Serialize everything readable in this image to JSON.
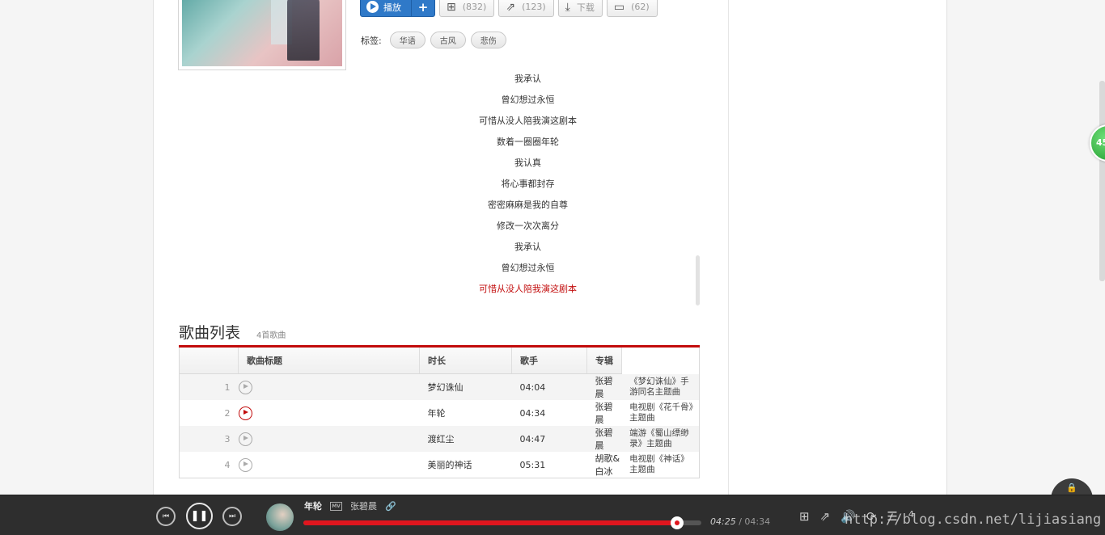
{
  "song_actions": {
    "play_label": "播放",
    "add_label": "+",
    "collect_count": "(832)",
    "share_count": "(123)",
    "download_label": "下载",
    "comment_count": "(62)"
  },
  "tags": {
    "label": "标签:",
    "items": [
      "华语",
      "古风",
      "悲伤"
    ]
  },
  "lyrics": {
    "lines": [
      "我承认",
      "曾幻想过永恒",
      "可惜从没人陪我演这剧本",
      "数着一圈圈年轮",
      "我认真",
      "将心事都封存",
      "密密麻麻是我的自尊",
      "修改一次次离分",
      "我承认",
      "曾幻想过永恒",
      "可惜从没人陪我演这剧本"
    ],
    "current_index": 10
  },
  "song_list": {
    "title": "歌曲列表",
    "count": "4首歌曲",
    "columns": {
      "title": "歌曲标题",
      "duration": "时长",
      "artist": "歌手",
      "album": "专辑"
    },
    "rows": [
      {
        "num": "1",
        "title": "梦幻诛仙",
        "duration": "04:04",
        "artist": "张碧晨",
        "album": "《梦幻诛仙》手游同名主题曲",
        "playing": false
      },
      {
        "num": "2",
        "title": "年轮",
        "duration": "04:34",
        "artist": "张碧晨",
        "album": "电视剧《花千骨》主题曲",
        "playing": true
      },
      {
        "num": "3",
        "title": "渡红尘",
        "duration": "04:47",
        "artist": "张碧晨",
        "album": "端游《蜀山缥缈录》主题曲",
        "playing": false
      },
      {
        "num": "4",
        "title": "美丽的神话",
        "duration": "05:31",
        "artist": "胡歌&白冰",
        "album": "电视剧《神话》主题曲",
        "playing": false
      }
    ]
  },
  "badge": {
    "value": "45"
  },
  "player": {
    "title": "年轮",
    "mv_label": "MV",
    "artist": "张碧晨",
    "elapsed": "04:25",
    "separator": "/",
    "total": "04:34",
    "progress": 0.94,
    "volume_count": "4"
  },
  "watermark": "http://blog.csdn.net/lijiasiang",
  "colors": {
    "accent": "#c20c0c",
    "play_button": "#2f79c8",
    "player_bg": "#2e2e2e"
  }
}
